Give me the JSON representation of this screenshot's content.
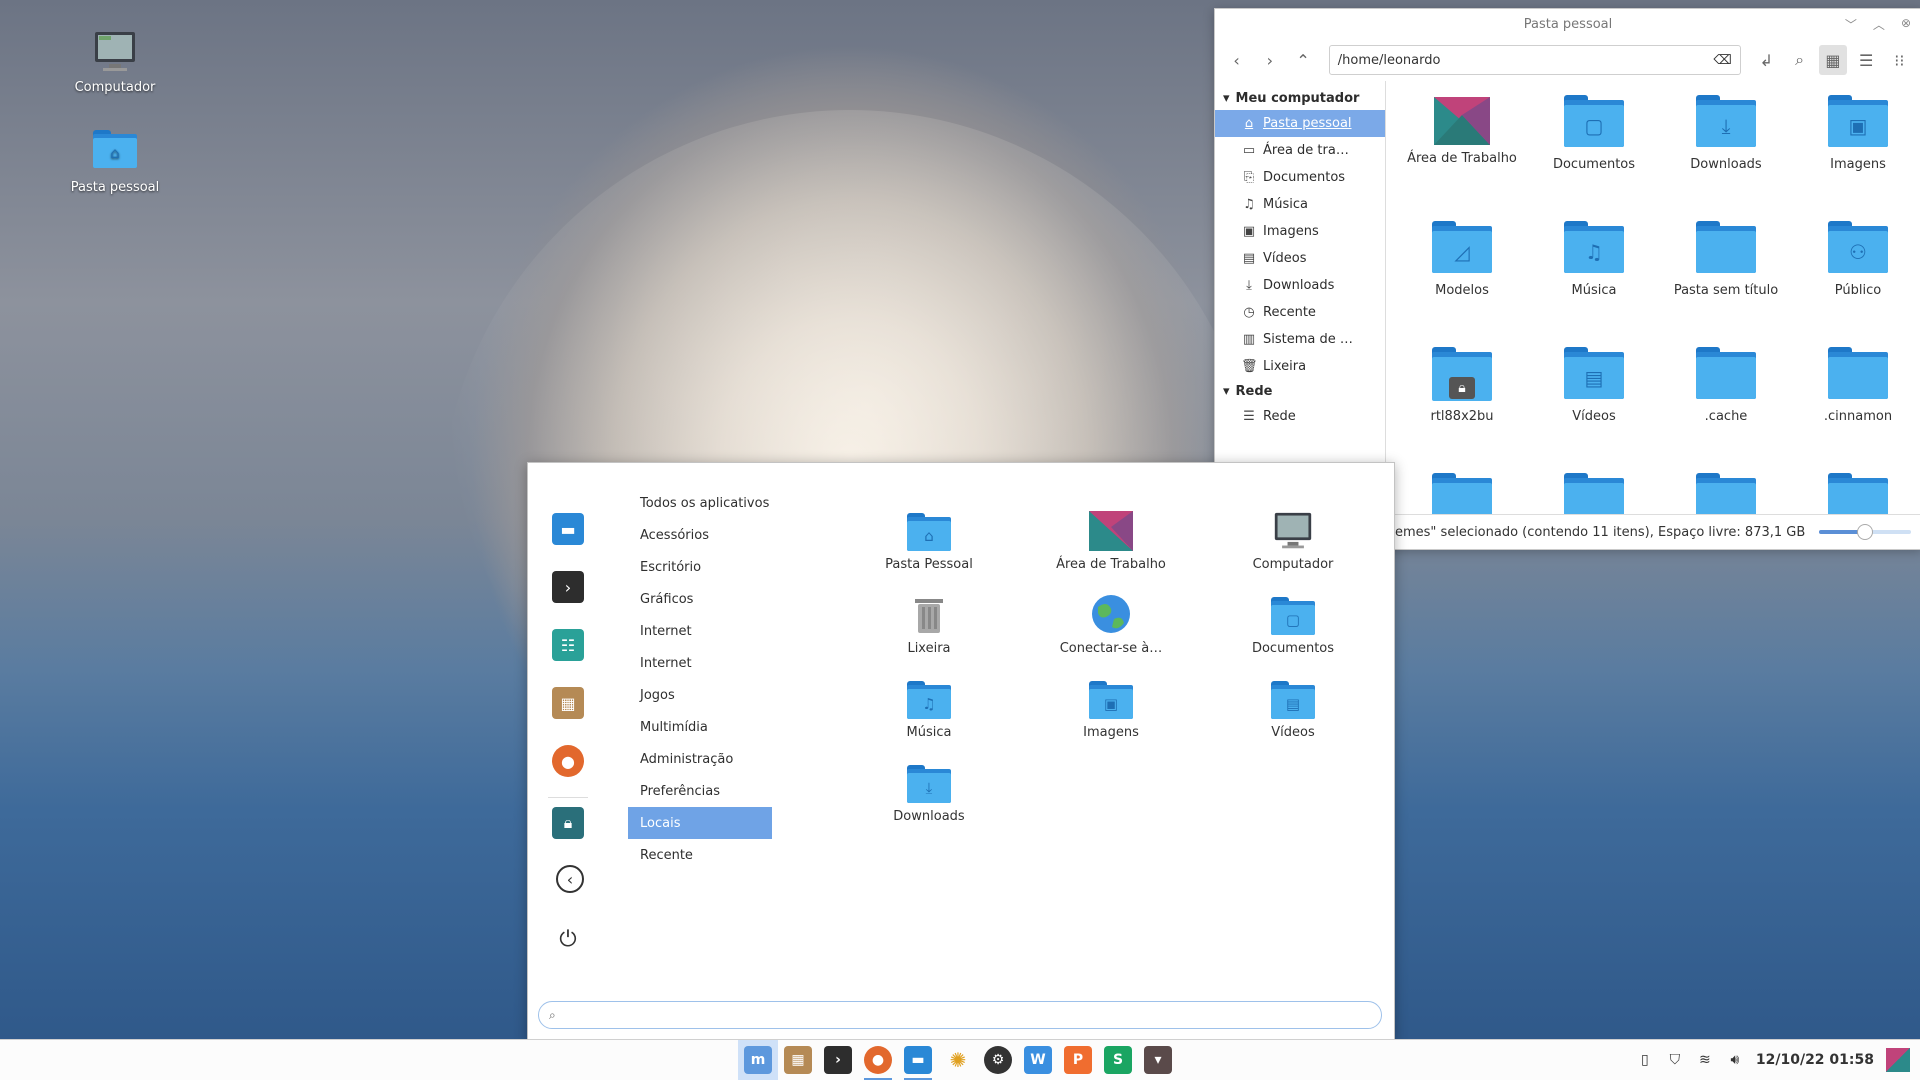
{
  "desktop": {
    "icons": [
      {
        "label": "Computador"
      },
      {
        "label": "Pasta pessoal"
      }
    ]
  },
  "file_manager": {
    "title": "Pasta pessoal",
    "path": "/home/leonardo",
    "sidebar": {
      "section_computer": "Meu computador",
      "items": [
        {
          "label": "Pasta pessoal",
          "icon": "home-icon"
        },
        {
          "label": "Área de tra…",
          "icon": "desktop-icon"
        },
        {
          "label": "Documentos",
          "icon": "document-icon"
        },
        {
          "label": "Música",
          "icon": "music-icon"
        },
        {
          "label": "Imagens",
          "icon": "image-icon"
        },
        {
          "label": "Vídeos",
          "icon": "video-icon"
        },
        {
          "label": "Downloads",
          "icon": "download-icon"
        },
        {
          "label": "Recente",
          "icon": "clock-icon"
        },
        {
          "label": "Sistema de …",
          "icon": "drive-icon"
        },
        {
          "label": "Lixeira",
          "icon": "trash-icon"
        }
      ],
      "section_network": "Rede",
      "network_items": [
        {
          "label": "Rede",
          "icon": "network-icon"
        }
      ]
    },
    "files": [
      {
        "name": "Área de Trabalho",
        "icon": "desktop-folder-icon"
      },
      {
        "name": "Documentos",
        "icon": "document-icon"
      },
      {
        "name": "Downloads",
        "icon": "download-icon"
      },
      {
        "name": "Imagens",
        "icon": "image-icon"
      },
      {
        "name": "Modelos",
        "icon": "template-icon"
      },
      {
        "name": "Música",
        "icon": "music-icon"
      },
      {
        "name": "Pasta sem título",
        "icon": "folder-icon"
      },
      {
        "name": "Público",
        "icon": "users-icon"
      },
      {
        "name": "rtl88x2bu",
        "icon": "lock-icon"
      },
      {
        "name": "Vídeos",
        "icon": "video-icon"
      },
      {
        "name": ".cache",
        "icon": "folder-icon"
      },
      {
        "name": ".cinnamon",
        "icon": "folder-icon"
      }
    ],
    "status": "emes\" selecionado (contendo 11 itens), Espaço livre: 873,1 GB"
  },
  "menu": {
    "categories": [
      "Todos os aplicativos",
      "Acessórios",
      "Escritório",
      "Gráficos",
      "Internet",
      "Internet",
      "Jogos",
      "Multimídia",
      "Administração",
      "Preferências",
      "Locais",
      "Recente"
    ],
    "selected_category": "Locais",
    "apps": [
      {
        "label": "Pasta Pessoal",
        "icon": "home-folder-icon"
      },
      {
        "label": "Área de Trabalho",
        "icon": "desktop-icon"
      },
      {
        "label": "Computador",
        "icon": "computer-icon"
      },
      {
        "label": "Lixeira",
        "icon": "trash-icon"
      },
      {
        "label": "Conectar-se à…",
        "icon": "globe-icon"
      },
      {
        "label": "Documentos",
        "icon": "document-folder-icon"
      },
      {
        "label": "Música",
        "icon": "music-folder-icon"
      },
      {
        "label": "Imagens",
        "icon": "image-folder-icon"
      },
      {
        "label": "Vídeos",
        "icon": "video-folder-icon"
      },
      {
        "label": "Downloads",
        "icon": "download-folder-icon"
      }
    ],
    "search_value": ""
  },
  "panel": {
    "clock": "12/10/22 01:58"
  },
  "colors": {
    "accent": "#6fa3e6",
    "folder": "#4bb1ef",
    "folder_dark": "#2a88d6"
  }
}
